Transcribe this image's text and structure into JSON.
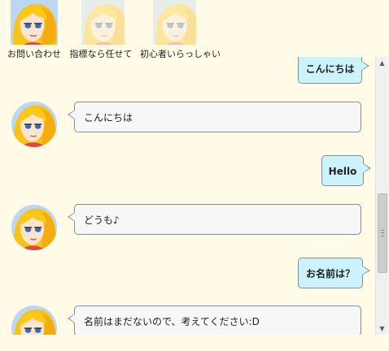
{
  "characters": [
    {
      "label": "お問い合わせ",
      "active": true
    },
    {
      "label": "指標なら任せて",
      "active": false
    },
    {
      "label": "初心者いらっしゃい",
      "active": false
    }
  ],
  "messages": [
    {
      "sender": "user",
      "text": "こんにちは"
    },
    {
      "sender": "bot",
      "text": "こんにちは"
    },
    {
      "sender": "user",
      "text": "Hello"
    },
    {
      "sender": "bot",
      "text": "どうも♪"
    },
    {
      "sender": "user",
      "text": "お名前は？"
    },
    {
      "sender": "bot",
      "text": "名前はまだないので、考えてください:D"
    }
  ],
  "colors": {
    "background": "#fffbe6",
    "user_bubble": "#ccf3fb",
    "bot_bubble": "#f7f7f7",
    "bubble_border": "#7f8f9a"
  },
  "icons": {
    "avatar": "blonde-girl-avatar-icon",
    "scroll_up": "scroll-up-arrow-icon",
    "scroll_down": "scroll-down-arrow-icon"
  }
}
